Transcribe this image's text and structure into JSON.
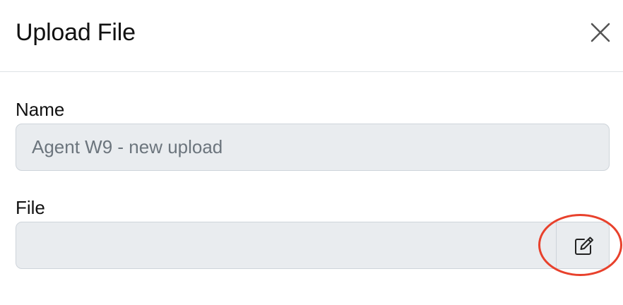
{
  "modal": {
    "title": "Upload File",
    "close_icon": "close-icon"
  },
  "form": {
    "name": {
      "label": "Name",
      "value": "Agent W9 - new upload"
    },
    "file": {
      "label": "File",
      "value": "",
      "edit_icon": "edit-icon"
    }
  },
  "annotation": {
    "highlight_color": "#e8412c"
  }
}
